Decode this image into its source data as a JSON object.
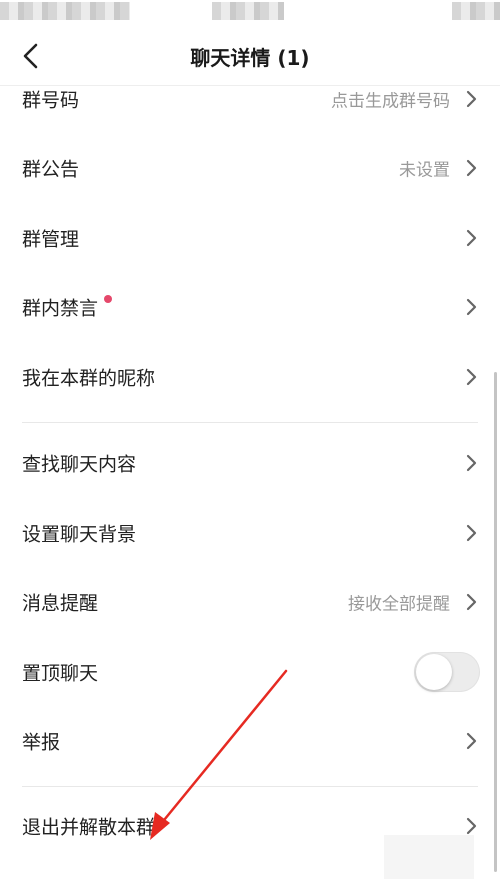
{
  "header": {
    "title": "聊天详情 (1)"
  },
  "icons": {
    "back": "chevron-left-icon",
    "row_arrow": "chevron-right-icon"
  },
  "colors": {
    "badge_dot": "#e5486b",
    "annotation_arrow": "#e62a22"
  },
  "section1": {
    "items": [
      {
        "label": "群号码",
        "value": "点击生成群号码"
      },
      {
        "label": "群公告",
        "value": "未设置"
      },
      {
        "label": "群管理",
        "value": ""
      },
      {
        "label": "群内禁言",
        "value": "",
        "badge": true
      },
      {
        "label": "我在本群的昵称",
        "value": ""
      }
    ]
  },
  "section2": {
    "items": [
      {
        "label": "查找聊天内容",
        "value": ""
      },
      {
        "label": "设置聊天背景",
        "value": ""
      },
      {
        "label": "消息提醒",
        "value": "接收全部提醒"
      },
      {
        "label": "置顶聊天",
        "toggle_on": false
      },
      {
        "label": "举报",
        "value": ""
      }
    ]
  },
  "section3": {
    "items": [
      {
        "label": "退出并解散本群"
      }
    ]
  }
}
